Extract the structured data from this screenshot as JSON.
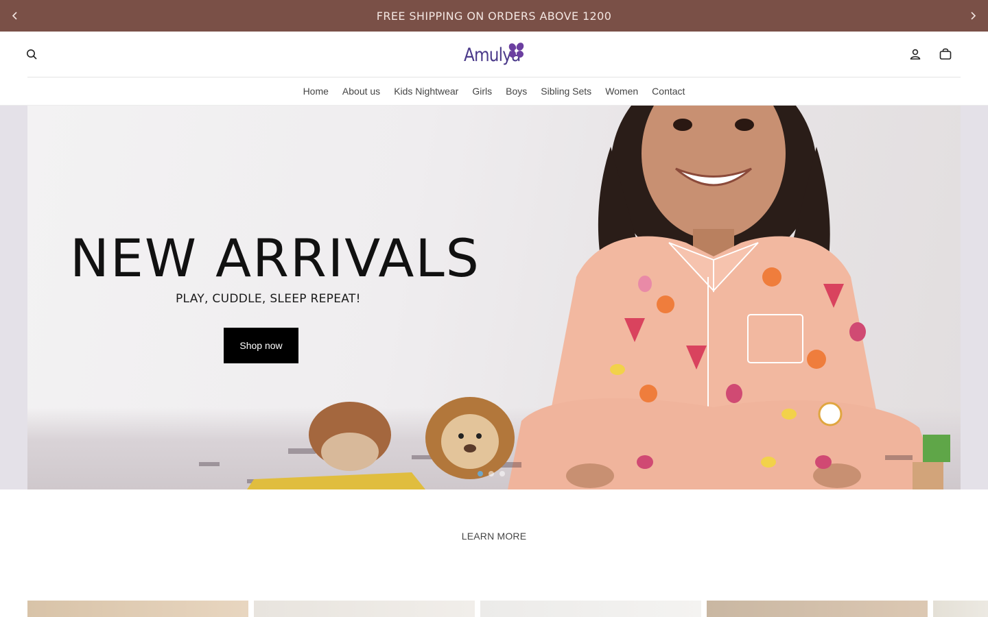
{
  "announcement": {
    "text": "FREE SHIPPING ON ORDERS ABOVE 1200",
    "prev_icon": "chevron-left-icon",
    "next_icon": "chevron-right-icon"
  },
  "header": {
    "logo_text": "Amulya",
    "search_icon": "search-icon",
    "account_icon": "account-icon",
    "cart_icon": "bag-icon"
  },
  "nav": {
    "items": [
      "Home",
      "About us",
      "Kids Nightwear",
      "Girls",
      "Boys",
      "Sibling Sets",
      "Women",
      "Contact"
    ]
  },
  "hero": {
    "heading": "NEW ARRIVALS",
    "subheading": "PLAY, CUDDLE, SLEEP REPEAT!",
    "button_label": "Shop now",
    "slide_count": 3,
    "active_slide": 1
  },
  "learn_more": {
    "label": "LEARN MORE"
  },
  "colors": {
    "announcement_bg": "#7a5047",
    "announcement_text": "#f3e6e2",
    "logo": "#4b3a8a",
    "button_bg": "#000000",
    "active_dot": "#6fa6c8"
  }
}
